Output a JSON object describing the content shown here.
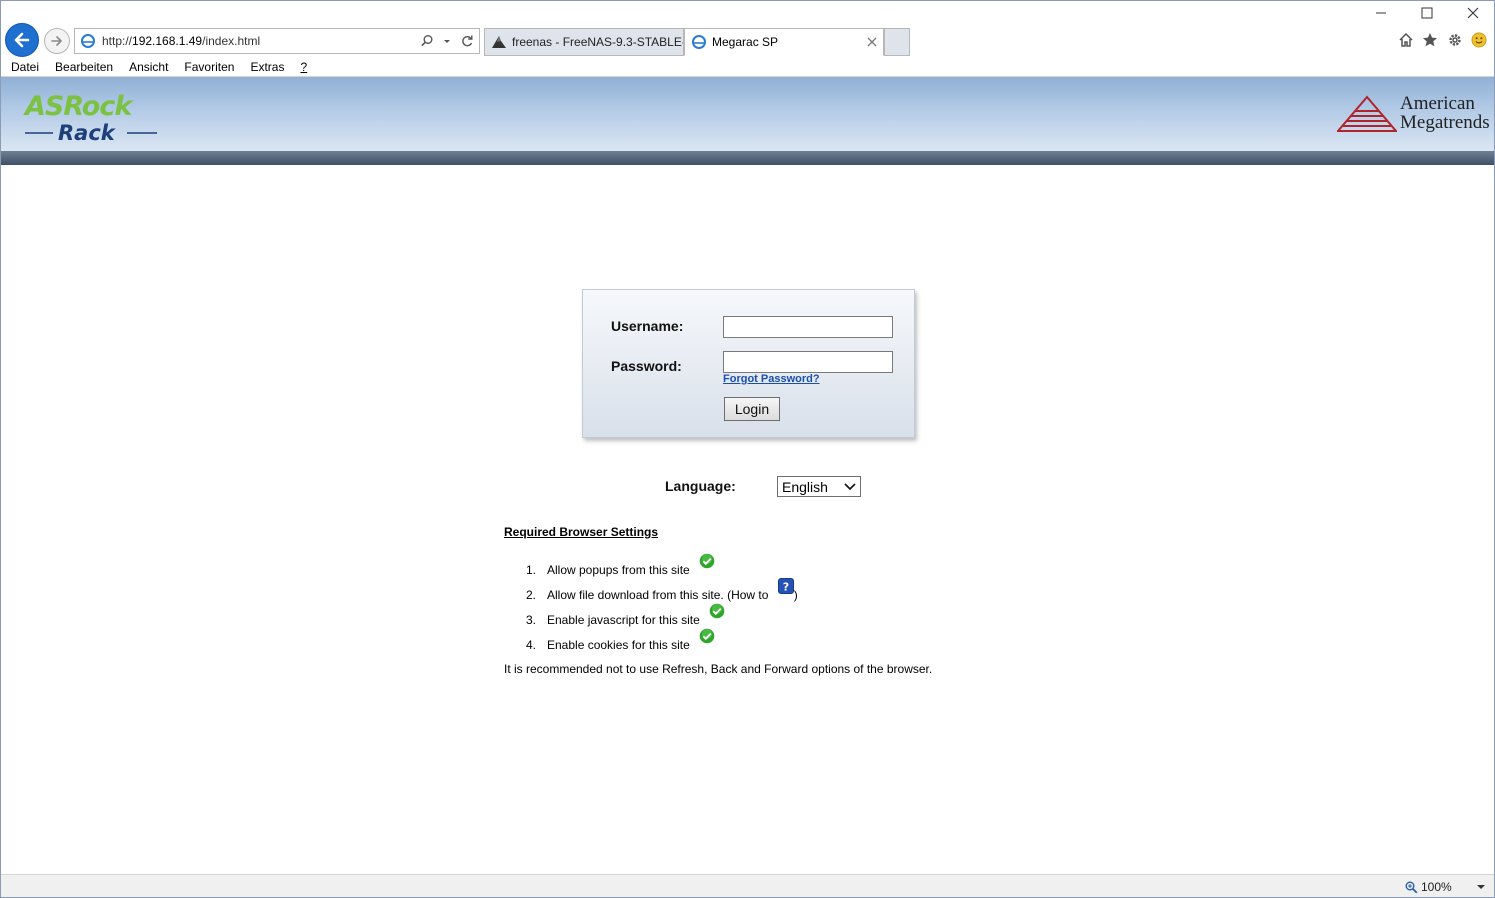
{
  "browser": {
    "url_prefix": "http://",
    "url_host": "192.168.1.49",
    "url_path": "/index.html",
    "tabs": [
      {
        "label": "freenas - FreeNAS-9.3-STABLE-...",
        "icon": "freenas-icon"
      },
      {
        "label": "Megarac SP",
        "icon": "ie-page-icon"
      }
    ],
    "menu": [
      "Datei",
      "Bearbeiten",
      "Ansicht",
      "Favoriten",
      "Extras",
      "?"
    ],
    "zoom": "100%"
  },
  "header": {
    "left_logo": "ASRock Rack",
    "right_logo_line1": "American",
    "right_logo_line2": "Megatrends"
  },
  "login": {
    "username_label": "Username:",
    "password_label": "Password:",
    "username_value": "",
    "password_value": "",
    "forgot_label": "Forgot Password?",
    "login_button": "Login"
  },
  "language": {
    "label": "Language:",
    "selected": "English"
  },
  "requirements": {
    "title": "Required Browser Settings",
    "items": [
      {
        "num": "1.",
        "text": "Allow popups from this site",
        "status": "check"
      },
      {
        "num": "2.",
        "text": "Allow file download from this site. (How to",
        "suffix": ")",
        "status": "help"
      },
      {
        "num": "3.",
        "text": "Enable javascript for this site",
        "status": "check"
      },
      {
        "num": "4.",
        "text": "Enable cookies for this site",
        "status": "check"
      }
    ],
    "note": "It is recommended not to use Refresh, Back and Forward options of the browser."
  },
  "colors": {
    "asrock_green": "#7cc242",
    "asrock_blue": "#1d3f7a",
    "ami_red": "#b0242c",
    "check_green": "#2fa62b",
    "help_blue": "#2553b5"
  }
}
